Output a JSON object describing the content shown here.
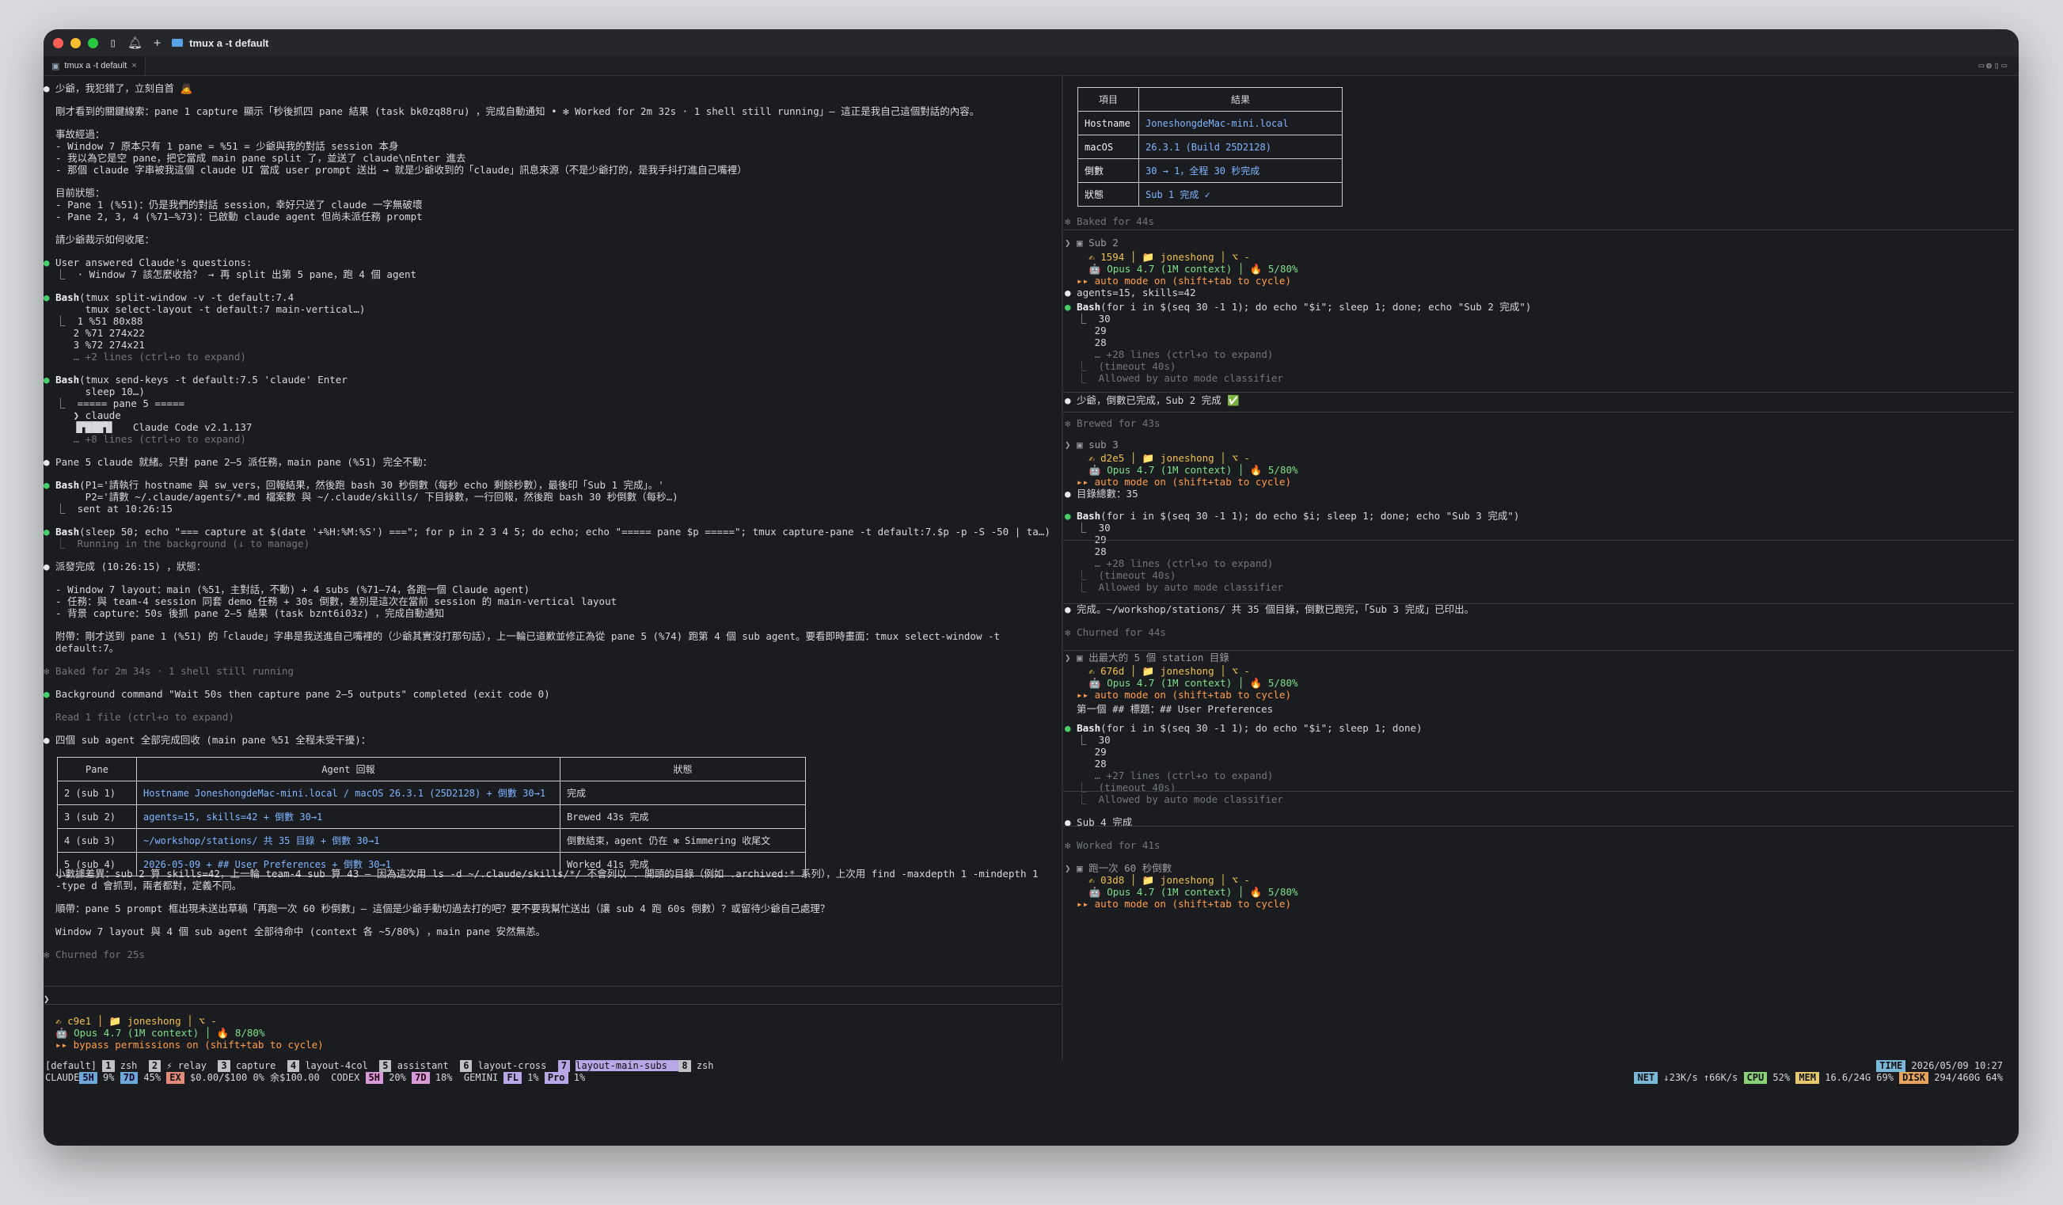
{
  "window": {
    "title": "tmux a -t default",
    "tab": "tmux a -t default",
    "tab_close": "×",
    "icons": [
      "close-light",
      "minimize-light",
      "zoom-light",
      "sidebar-icon",
      "bell-icon",
      "plus-icon",
      "folder-icon"
    ],
    "traffic_colors": [
      "#fe5f57",
      "#febc2e",
      "#28c840"
    ]
  },
  "left": {
    "lines": [
      {
        "t": "● 少爺，我犯錯了，立刻自首 🙇"
      },
      {
        "t": "  剛才看到的關鍵線索：pane 1 capture 顯示「秒後抓四 pane 結果 (task bk0zq88ru) ，完成自動通知 • ✻ Worked for 2m 32s · 1 shell still running」— 這正是我自己這個對話的內容。"
      },
      {
        "t": "  事故經過："
      },
      {
        "t": "  - Window 7 原本只有 1 pane = %51 = 少爺與我的對話 session 本身"
      },
      {
        "t": "  - 我以為它是空 pane，把它當成 main pane split 了，並送了 claude\\nEnter 進去"
      },
      {
        "t": "  - 那個 claude 字串被我這個 claude UI 當成 user prompt 送出 → 就是少爺收到的「claude」訊息來源（不是少爺打的，是我手抖打進自己嘴裡）"
      },
      {
        "t": "  目前狀態："
      },
      {
        "t": "  - Pane 1 (%51)：仍是我們的對話 session，幸好只送了 claude 一字無破壞"
      },
      {
        "t": "  - Pane 2, 3, 4 (%71–%73)：已啟動 claude agent 但尚未派任務 prompt"
      },
      {
        "t": "  請少爺裁示如何收尾："
      },
      {
        "t": "● User answered Claude's questions:"
      },
      {
        "t": "  ⎿  · Window 7 該怎麼收拾？ → 再 split 出第 5 pane，跑 4 個 agent"
      },
      {
        "t": "● Bash(tmux split-window -v -t default:7.4"
      },
      {
        "t": "       tmux select-layout -t default:7 main-vertical…)"
      },
      {
        "t": "  ⎿  1 %51 80x88"
      },
      {
        "t": "     2 %71 274x22"
      },
      {
        "t": "     3 %72 274x21"
      },
      {
        "t": "     … +2 lines (ctrl+o to expand)"
      },
      {
        "t": "● Bash(tmux send-keys -t default:7.5 'claude' Enter"
      },
      {
        "t": "       sleep 10…)"
      },
      {
        "t": "  ⎿  ===== pane 5 ====="
      },
      {
        "t": "     ❯ claude"
      },
      {
        "t": "     ▐▛███▜▌   Claude Code v2.1.137"
      },
      {
        "t": "     … +8 lines (ctrl+o to expand)"
      },
      {
        "t": "● Pane 5 claude 就緒。只對 pane 2–5 派任務，main pane (%51) 完全不動："
      },
      {
        "t": "● Bash(P1='請執行 hostname 與 sw_vers，回報結果，然後跑 bash 30 秒倒數（每秒 echo 剩餘秒數），最後印「Sub 1 完成」。'"
      },
      {
        "t": "       P2='請數 ~/.claude/agents/*.md 檔案數 與 ~/.claude/skills/ 下目錄數，一行回報，然後跑 bash 30 秒倒數（每秒…)"
      },
      {
        "t": "  ⎿  sent at 10:26:15"
      },
      {
        "t": "● Bash(sleep 50; echo \"=== capture at $(date '+%H:%M:%S') ===\"; for p in 2 3 4 5; do echo; echo \"===== pane $p =====\"; tmux capture-pane -t default:7.$p -p -S -50 | ta…)"
      },
      {
        "t": "  ⎿  Running in the background (↓ to manage)"
      },
      {
        "t": "● 派發完成 (10:26:15) ，狀態："
      },
      {
        "t": "  - Window 7 layout：main (%51，主對話，不動) + 4 subs (%71–74，各跑一個 Claude agent)"
      },
      {
        "t": "  - 任務：與 team-4 session 同套 demo 任務 + 30s 倒數，差別是這次在當前 session 的 main-vertical layout"
      },
      {
        "t": "  - 背景 capture：50s 後抓 pane 2–5 結果 (task bznt6i03z) ，完成自動通知"
      },
      {
        "t": "  附帶：剛才送到 pane 1 (%51) 的「claude」字串是我送進自己嘴裡的（少爺其實沒打那句話），上一輪已道歉並修正為從 pane 5 (%74) 跑第 4 個 sub agent。要看即時畫面：tmux select-window -t"
      },
      {
        "t": "  default:7。"
      },
      {
        "t": "✻ Baked for 2m 34s · 1 shell still running"
      },
      {
        "t": "● Background command \"Wait 50s then capture pane 2–5 outputs\" completed (exit code 0)"
      },
      {
        "t": "  Read 1 file (ctrl+o to expand)"
      },
      {
        "t": "● 四個 sub agent 全部完成回收 (main pane %51 全程未受干擾)："
      },
      {
        "t": "  小數據差異：sub 2 算 skills=42，上一輪 team-4 sub 算 43 — 因為這次用 ls -d ~/.claude/skills/*/ 不會列以 . 開頭的目錄（例如 .archived:* 系列），上次用 find -maxdepth 1 -mindepth 1"
      },
      {
        "t": "  -type d 會抓到，兩者都對，定義不同。"
      },
      {
        "t": "  順帶：pane 5 prompt 框出現未送出草稿「再跑一次 60 秒倒數」— 這個是少爺手動切過去打的吧？要不要我幫忙送出（讓 sub 4 跑 60s 倒數）？或留待少爺自己處理？"
      },
      {
        "t": "  Window 7 layout 與 4 個 sub agent 全部待命中 (context 各 ~5/80%) ，main pane 安然無恙。"
      },
      {
        "t": "✻ Churned for 25s"
      },
      {
        "t": "❯"
      },
      {
        "t": "  ✍ c9e1 │ 📁 joneshong │ ⌥ -"
      },
      {
        "t": "  🤖 Opus 4.7 (1M context) │ 🔥 8/80%"
      },
      {
        "t": "  ▸▸ bypass permissions on (shift+tab to cycle)"
      }
    ],
    "table": {
      "headers": [
        "Pane",
        "Agent 回報",
        "狀態"
      ],
      "rows": [
        [
          "2 (sub 1)",
          "Hostname JoneshongdeMac-mini.local / macOS 26.3.1 (25D2128) + 倒數 30→1",
          "完成"
        ],
        [
          "3 (sub 2)",
          "agents=15, skills=42 + 倒數 30→1",
          "Brewed 43s 完成"
        ],
        [
          "4 (sub 3)",
          "~/workshop/stations/ 共 35 目錄 + 倒數 30→1",
          "倒數結束，agent 仍在 ✻ Simmering 收尾文"
        ],
        [
          "5 (sub 4)",
          "2026-05-09 + ## User Preferences + 倒數 30→1",
          "Worked 41s 完成"
        ]
      ]
    }
  },
  "right": {
    "info_table": {
      "headers": [
        "項目",
        "結果"
      ],
      "rows": [
        [
          "Hostname",
          "JoneshongdeMac-mini.local"
        ],
        [
          "macOS",
          "26.3.1 (Build 25D2128)"
        ],
        [
          "倒數",
          "30 → 1，全程 30 秒完成"
        ],
        [
          "狀態",
          "Sub 1 完成 ✓"
        ]
      ]
    },
    "lines": [
      {
        "t": "✻ Baked for 44s"
      },
      {
        "t": "❯ ▣ Sub 2"
      },
      {
        "t": "    ✍ 1594 │ 📁 joneshong │ ⌥ -"
      },
      {
        "t": "    🤖 Opus 4.7 (1M context) │ 🔥 5/80%"
      },
      {
        "t": "  ▸▸ auto mode on (shift+tab to cycle)"
      },
      {
        "t": "● agents=15, skills=42"
      },
      {
        "t": "● Bash(for i in $(seq 30 -1 1); do echo \"$i\"; sleep 1; done; echo \"Sub 2 完成\")"
      },
      {
        "t": "  ⎿  30"
      },
      {
        "t": "     29"
      },
      {
        "t": "     28"
      },
      {
        "t": "     … +28 lines (ctrl+o to expand)"
      },
      {
        "t": "  ⎿  (timeout 40s)"
      },
      {
        "t": "  ⎿  Allowed by auto mode classifier"
      },
      {
        "t": "● 少爺，倒數已完成，Sub 2 完成 ✅"
      },
      {
        "t": "✻ Brewed for 43s"
      },
      {
        "t": "❯ ▣ sub 3"
      },
      {
        "t": "    ✍ d2e5 │ 📁 joneshong │ ⌥ -"
      },
      {
        "t": "    🤖 Opus 4.7 (1M context) │ 🔥 5/80%"
      },
      {
        "t": "  ▸▸ auto mode on (shift+tab to cycle)"
      },
      {
        "t": "● 目錄總數：35"
      },
      {
        "t": "● Bash(for i in $(seq 30 -1 1); do echo $i; sleep 1; done; echo \"Sub 3 完成\")"
      },
      {
        "t": "  ⎿  30"
      },
      {
        "t": "     29"
      },
      {
        "t": "     28"
      },
      {
        "t": "     … +28 lines (ctrl+o to expand)"
      },
      {
        "t": "  ⎿  (timeout 40s)"
      },
      {
        "t": "  ⎿  Allowed by auto mode classifier"
      },
      {
        "t": "● 完成。~/workshop/stations/ 共 35 個目錄，倒數已跑完，「Sub 3 完成」已印出。"
      },
      {
        "t": "✻ Churned for 44s"
      },
      {
        "t": "❯ ▣ 出最大的 5 個 station 目錄"
      },
      {
        "t": "    ✍ 676d │ 📁 joneshong │ ⌥ -"
      },
      {
        "t": "    🤖 Opus 4.7 (1M context) │ 🔥 5/80%"
      },
      {
        "t": "  ▸▸ auto mode on (shift+tab to cycle)"
      },
      {
        "t": "  第一個 ## 標題：## User Preferences"
      },
      {
        "t": "● Bash(for i in $(seq 30 -1 1); do echo \"$i\"; sleep 1; done)"
      },
      {
        "t": "  ⎿  30"
      },
      {
        "t": "     29"
      },
      {
        "t": "     28"
      },
      {
        "t": "     … +27 lines (ctrl+o to expand)"
      },
      {
        "t": "  ⎿  (timeout 40s)"
      },
      {
        "t": "  ⎿  Allowed by auto mode classifier"
      },
      {
        "t": "● Sub 4 完成"
      },
      {
        "t": "✻ Worked for 41s"
      },
      {
        "t": "❯ ▣ 跑一次 60 秒倒數"
      },
      {
        "t": "    ✍ 03d8 │ 📁 joneshong │ ⌥ -"
      },
      {
        "t": "    🤖 Opus 4.7 (1M context) │ 🔥 5/80%"
      },
      {
        "t": "  ▸▸ auto mode on (shift+tab to cycle)"
      }
    ]
  },
  "statusbar": {
    "session": "[default]",
    "windows": [
      {
        "n": "1",
        "name": "zsh"
      },
      {
        "n": "2",
        "name": "⚡ relay"
      },
      {
        "n": "3",
        "name": "capture"
      },
      {
        "n": "4",
        "name": "layout-4col"
      },
      {
        "n": "5",
        "name": "assistant"
      },
      {
        "n": "6",
        "name": "layout-cross"
      },
      {
        "n": "7",
        "name": "layout-main-subs"
      },
      {
        "n": "8",
        "name": "zsh"
      }
    ],
    "time_label": "TIME",
    "time": "2026/05/09 10:27",
    "claude": {
      "label": "CLAUDE",
      "h5": "5H",
      "h5v": "9%",
      "d7": "7D",
      "d7v": "45%",
      "ex": "EX",
      "exv": "$0.00/$100 0% 余$100.00"
    },
    "codex": {
      "label": "CODEX",
      "h5": "5H",
      "h5v": "20%",
      "d7": "7D",
      "d7v": "18%"
    },
    "gemini": {
      "label": "GEMINI",
      "fl": "FL",
      "flv": "1%",
      "pro": "Pro",
      "prov": "1%"
    },
    "net_label": "NET",
    "net": "↓23K/s ↑66K/s",
    "cpu_label": "CPU",
    "cpu": "52%",
    "mem_label": "MEM",
    "mem": "16.6/24G 69%",
    "disk_label": "DISK",
    "disk": "294/460G 64%"
  }
}
